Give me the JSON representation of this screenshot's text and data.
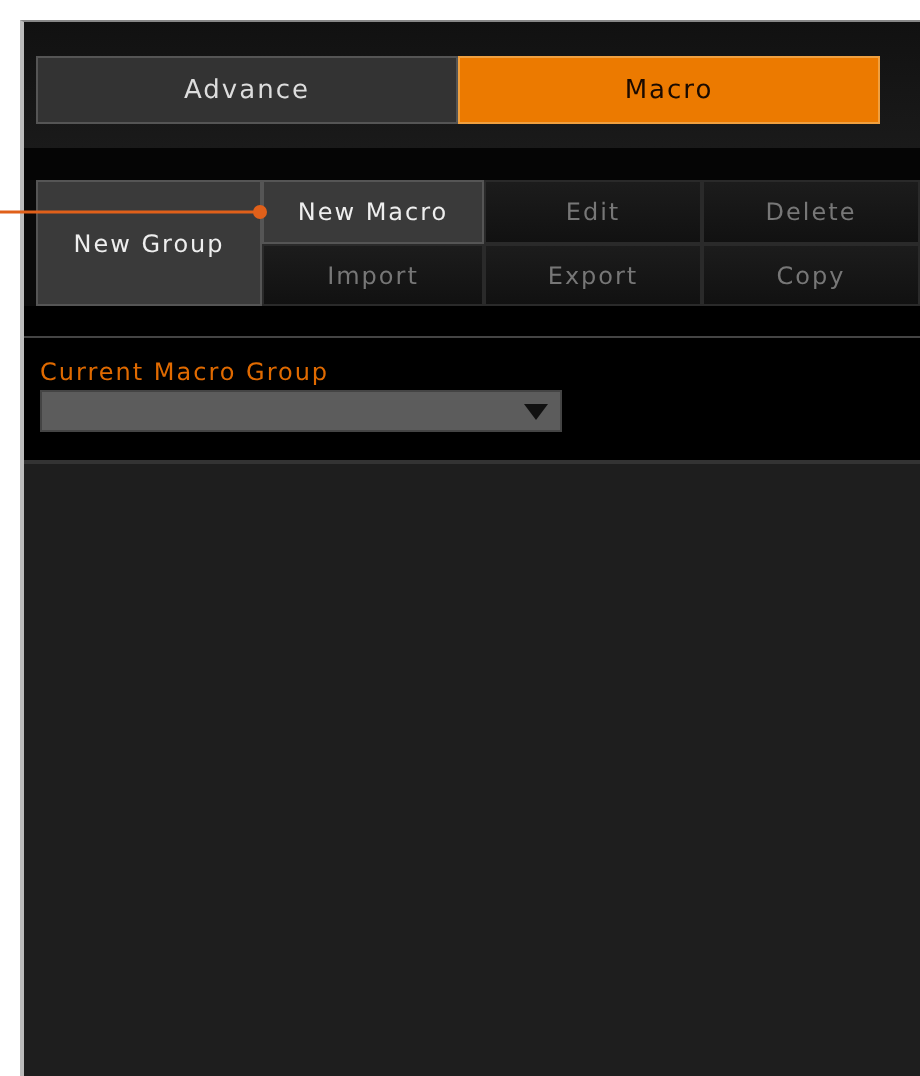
{
  "tabs": [
    {
      "label": "Advance",
      "selected": false
    },
    {
      "label": "Macro",
      "selected": true
    }
  ],
  "group_button": {
    "label": "New Group"
  },
  "actions": [
    {
      "label": "New Macro",
      "selected": true
    },
    {
      "label": "Edit",
      "selected": false
    },
    {
      "label": "Delete",
      "selected": false
    },
    {
      "label": "Import",
      "selected": false
    },
    {
      "label": "Export",
      "selected": false
    },
    {
      "label": "Copy",
      "selected": false
    }
  ],
  "callout": {
    "kind": "line"
  },
  "macro_group": {
    "label": "Current Macro Group"
  }
}
